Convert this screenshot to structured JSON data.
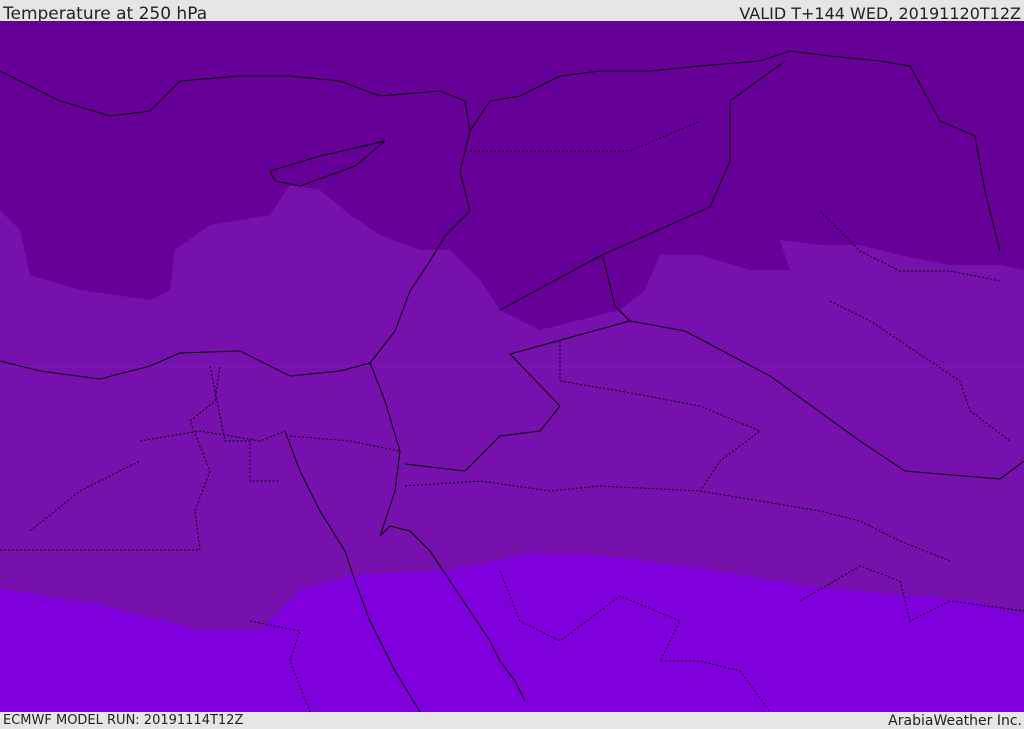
{
  "header": {
    "title": "Temperature at 250 hPa",
    "valid": "VALID T+144 WED, 20191120T12Z"
  },
  "footer": {
    "model_run": "ECMWF MODEL RUN: 20191114T12Z",
    "brand": "ArabiaWeather Inc."
  },
  "colors": {
    "band_cold": "#660099",
    "band_mid": "#7711ad",
    "band_warm": "#7f00dc",
    "border": "#000000"
  }
}
